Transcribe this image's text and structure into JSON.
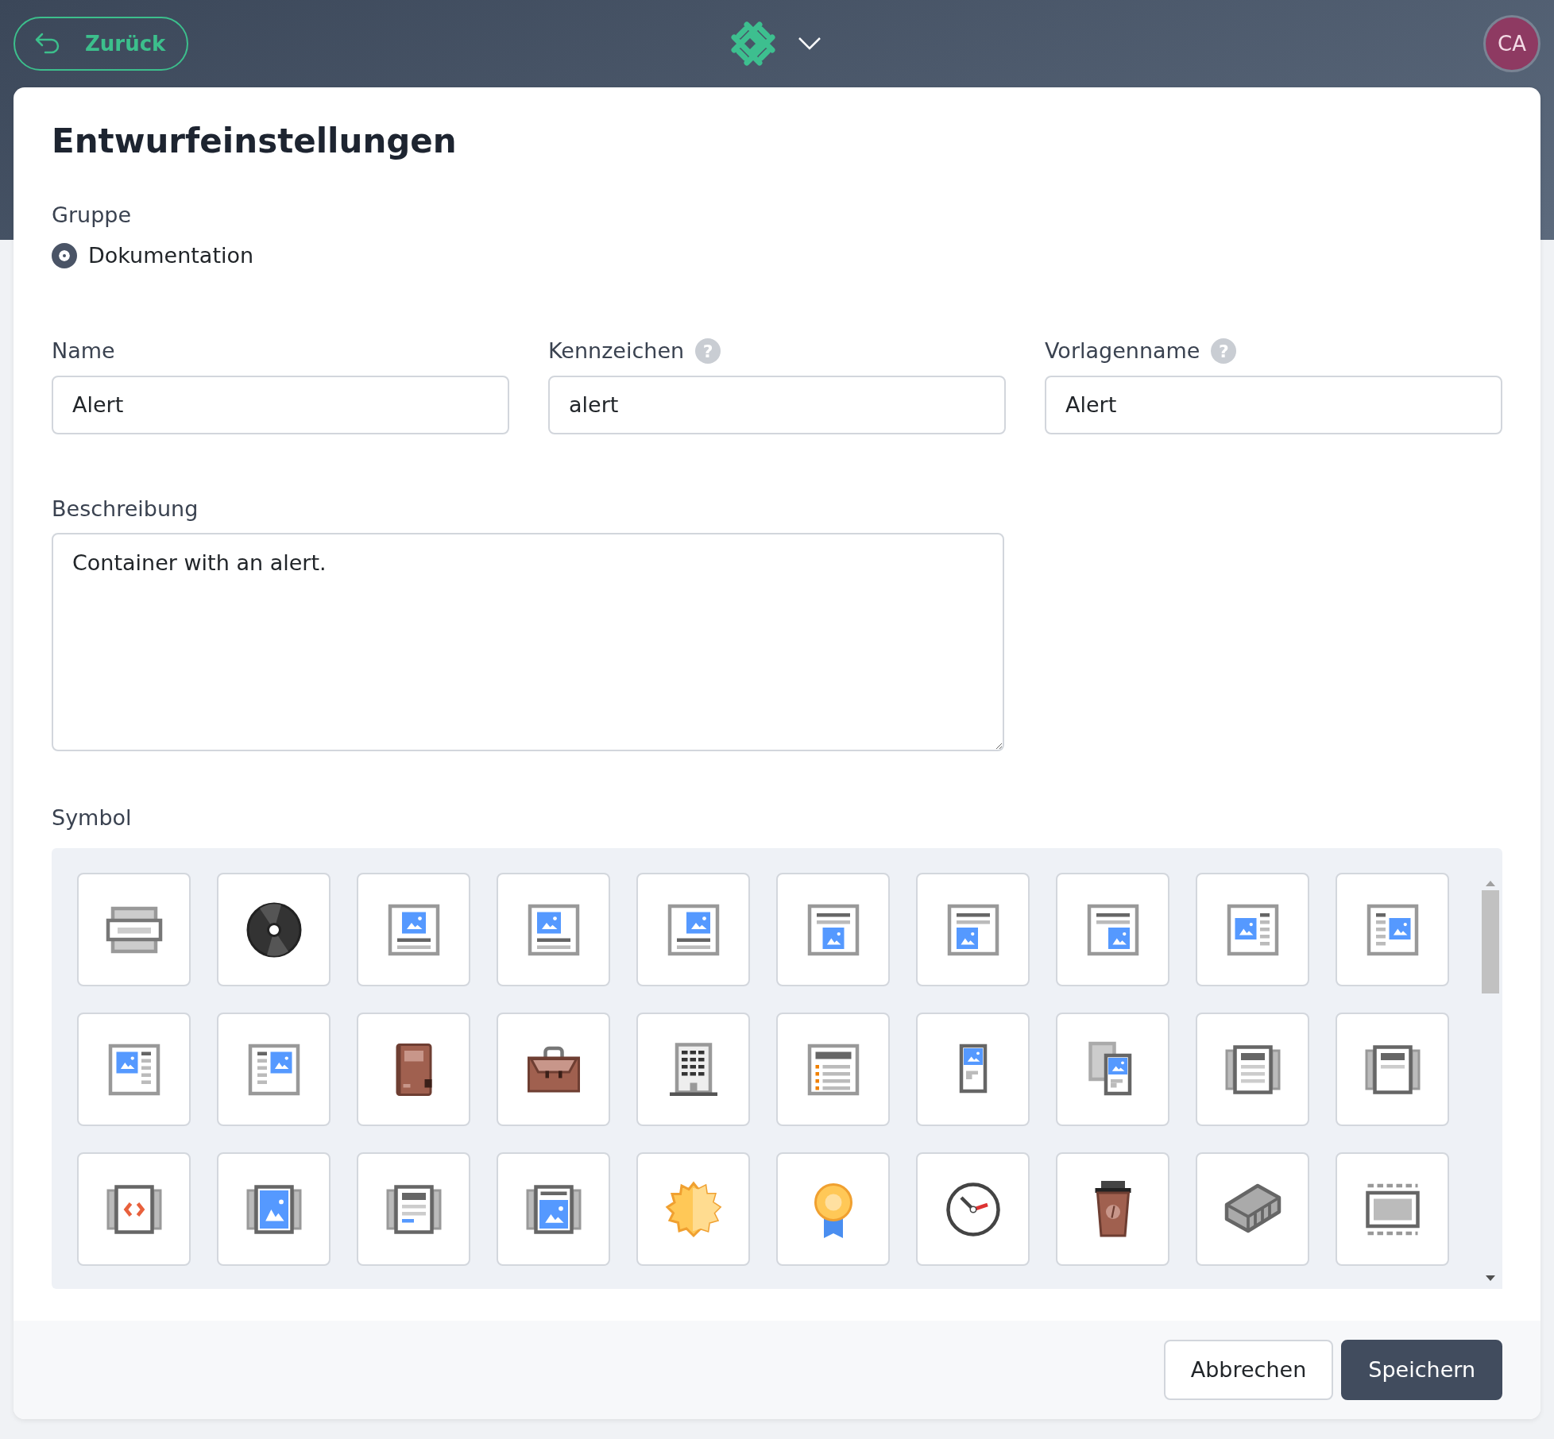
{
  "header": {
    "back_button": "Zurück",
    "avatar": "CA"
  },
  "dialog": {
    "title": "Entwurfeinstellungen",
    "group": {
      "label": "Gruppe",
      "options": [
        {
          "label": "Dokumentation",
          "selected": true
        }
      ]
    },
    "fields": [
      {
        "label": "Name",
        "value": "Alert"
      },
      {
        "label": "Kennzeichen",
        "value": "alert",
        "help": "?"
      },
      {
        "label": "Vorlagenname",
        "value": "Alert",
        "help": "?"
      }
    ],
    "description": {
      "label": "Beschreibung",
      "value": "Container with an alert."
    },
    "symbol": {
      "label": "Symbol"
    },
    "buttons": [
      {
        "label": "Abbrechen",
        "kind": "secondary"
      },
      {
        "label": "Speichern",
        "kind": "primary"
      }
    ]
  }
}
